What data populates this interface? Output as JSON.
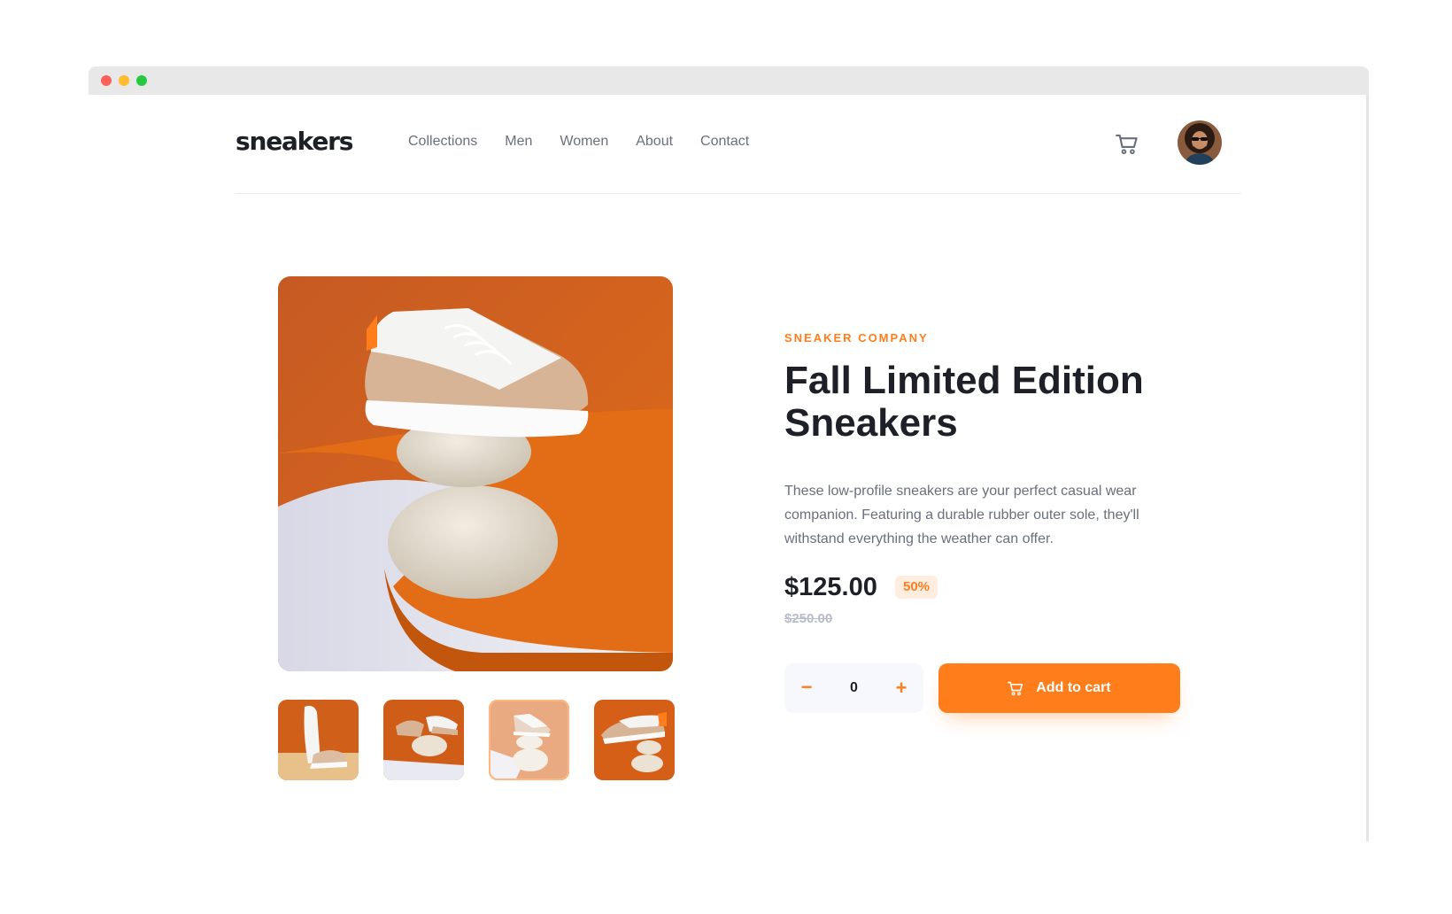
{
  "header": {
    "logo": "sneakers",
    "nav": [
      "Collections",
      "Men",
      "Women",
      "About",
      "Contact"
    ],
    "cart_icon": "cart-icon",
    "avatar_icon": "user-avatar"
  },
  "gallery": {
    "thumbnails": [
      {
        "name": "product-thumbnail-1",
        "active": false
      },
      {
        "name": "product-thumbnail-2",
        "active": false
      },
      {
        "name": "product-thumbnail-3",
        "active": true
      },
      {
        "name": "product-thumbnail-4",
        "active": false
      }
    ]
  },
  "product": {
    "company": "SNEAKER COMPANY",
    "title": "Fall Limited Edition Sneakers",
    "description": "These low-profile sneakers are your perfect casual wear companion. Featuring a durable rubber outer sole, they'll withstand everything the weather can offer.",
    "price": "$125.00",
    "discount": "50%",
    "original_price": "$250.00"
  },
  "cart_controls": {
    "minus": "−",
    "quantity": "0",
    "plus": "+",
    "add_label": "Add to cart"
  },
  "colors": {
    "accent": "#ff7d1a",
    "accent_pale": "#ffede0",
    "text_dark": "#1d2026",
    "text_gray": "#69707d",
    "text_light": "#b6bcc8",
    "stepper_bg": "#f6f8fd"
  }
}
